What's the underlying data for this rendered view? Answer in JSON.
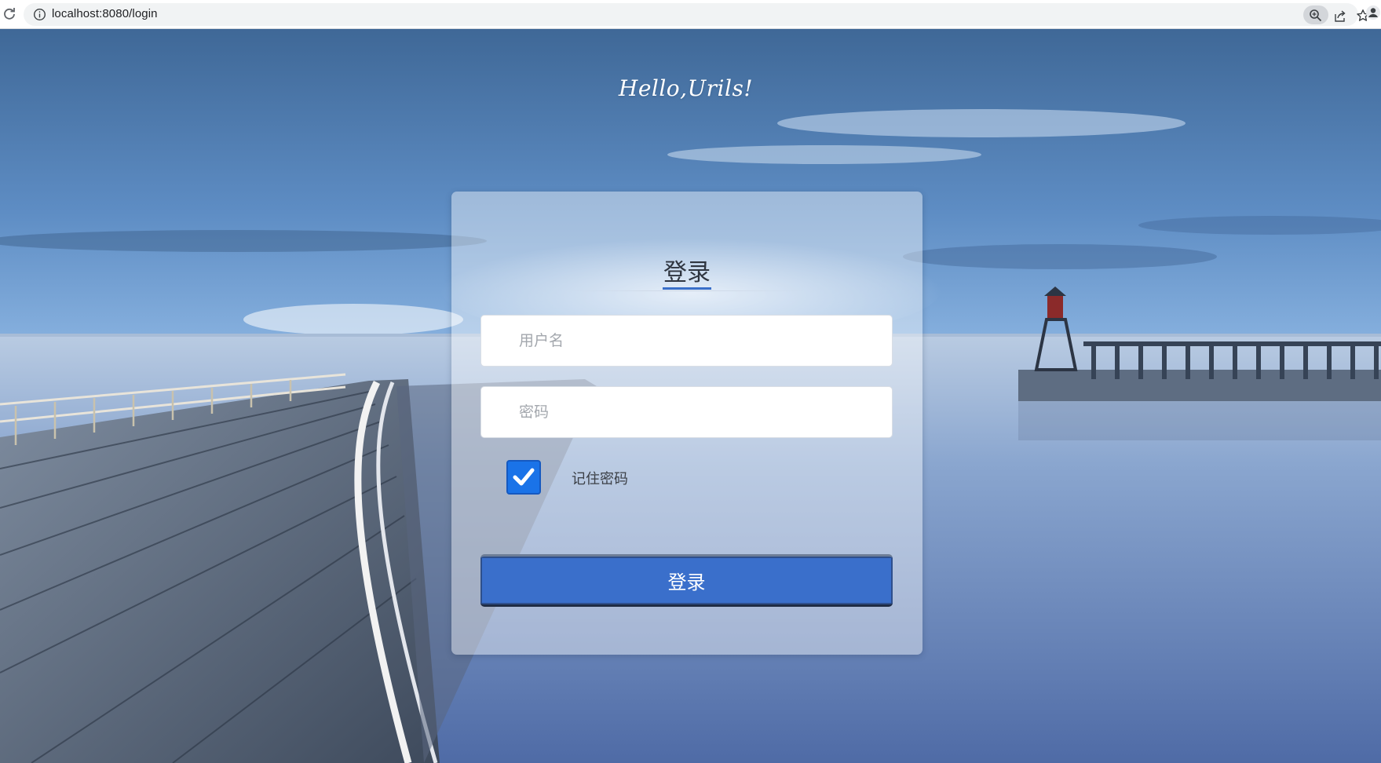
{
  "browser": {
    "url": "localhost:8080/login"
  },
  "page": {
    "hero_title": "Hello,Urils!"
  },
  "login_form": {
    "title": "登录",
    "username_placeholder": "用户名",
    "password_placeholder": "密码",
    "remember_label": "记住密码",
    "remember_checked": true,
    "submit_label": "登录"
  },
  "colors": {
    "accent": "#3a6fcb",
    "checkbox": "#1a73e8"
  },
  "icons": {
    "reload": "reload-icon",
    "info": "info-icon",
    "zoom": "zoom-icon",
    "share": "share-icon",
    "star": "star-icon",
    "profile": "profile-icon",
    "checkmark": "checkmark-icon"
  }
}
